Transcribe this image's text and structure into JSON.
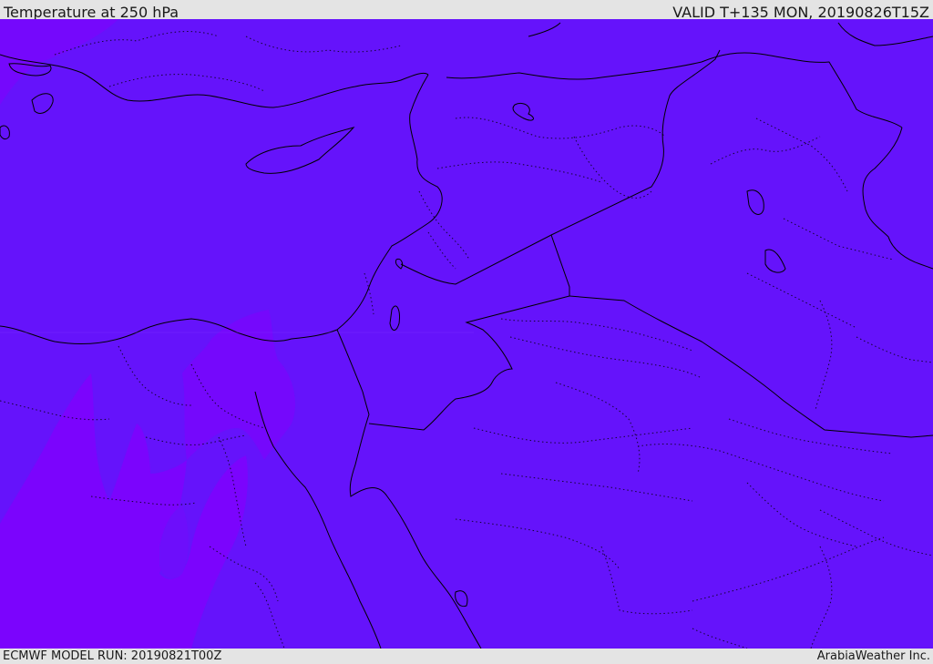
{
  "header": {
    "title": "Temperature at 250 hPa",
    "valid_time": "VALID T+135 MON, 20190826T15Z"
  },
  "footer": {
    "model_run": "ECMWF MODEL RUN: 20190821T00Z",
    "credit": "ArabiaWeather Inc."
  },
  "map": {
    "colors": {
      "base_fill": "#6513fb",
      "warm_fill": "#7e00fd",
      "mid_fill": "#7508fc",
      "border_line": "#000000"
    }
  }
}
